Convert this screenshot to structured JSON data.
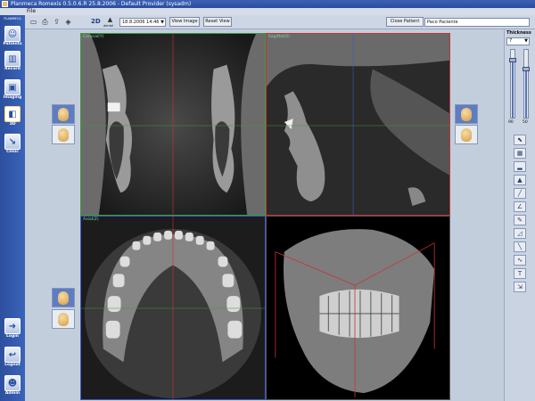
{
  "window": {
    "title": "Planmeca Romexis 0.5.0.6.R 25.8.2006 - Default Provider (sysadm)"
  },
  "menu": {
    "file": "File"
  },
  "nav": {
    "logo": "PLANMECA",
    "items": [
      {
        "label": "Patients",
        "icon": "patients-icon"
      },
      {
        "label": "Record",
        "icon": "record-icon"
      },
      {
        "label": "Imaging",
        "icon": "imaging-icon"
      },
      {
        "label": "3D",
        "icon": "3d-icon"
      },
      {
        "label": "Clinic",
        "icon": "clinic-icon"
      },
      {
        "label": "Login",
        "icon": "login-icon"
      },
      {
        "label": "Logout",
        "icon": "logout-icon"
      },
      {
        "label": "Admin",
        "icon": "admin-icon"
      }
    ]
  },
  "toolbar": {
    "mode_2d": "2D",
    "mode_3d_label": "dental",
    "date_select": "18.8.2006 14:46",
    "view_image": "View Image",
    "reset_view": "Reset View",
    "close_patient": "Close Patient",
    "patient_name": "Paco Paciente"
  },
  "views": {
    "coronal": "Coronal(Y)",
    "sagittal": "Sagittal(X)",
    "axial": "Axial(Z)"
  },
  "right": {
    "thickness_label": "Thickness",
    "thickness_value": "7",
    "slider_left": "90",
    "slider_right": "50",
    "slider_left_level": 0.86,
    "slider_right_level": 0.72
  }
}
